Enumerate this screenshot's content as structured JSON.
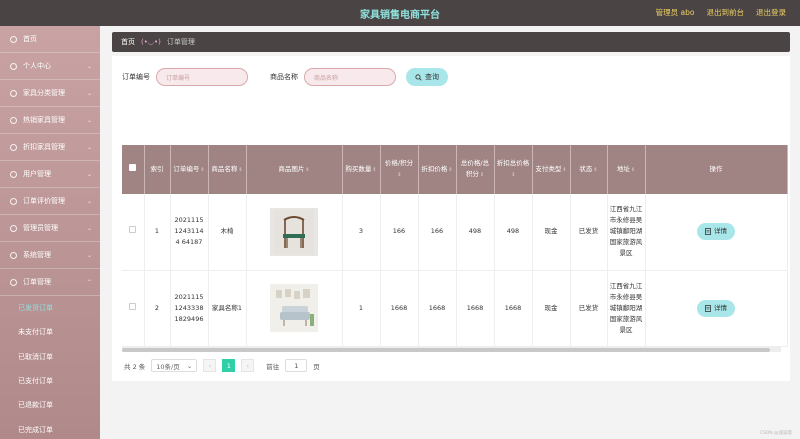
{
  "header": {
    "title": "家具销售电商平台",
    "user": "管理员 abo",
    "to_front": "退出到前台",
    "logout": "退出登录"
  },
  "sidebar": {
    "items": [
      {
        "label": "首页"
      },
      {
        "label": "个人中心"
      },
      {
        "label": "家具分类管理"
      },
      {
        "label": "热销家具管理"
      },
      {
        "label": "折扣家具管理"
      },
      {
        "label": "用户管理"
      },
      {
        "label": "订单评价管理"
      },
      {
        "label": "管理员管理"
      },
      {
        "label": "系统管理"
      },
      {
        "label": "订单管理"
      }
    ],
    "sub_items": [
      {
        "label": "已发货订单"
      },
      {
        "label": "未支付订单"
      },
      {
        "label": "已取消订单"
      },
      {
        "label": "已支付订单"
      },
      {
        "label": "已退款订单"
      },
      {
        "label": "已完成订单"
      }
    ]
  },
  "breadcrumb": {
    "home": "首页",
    "sep": "(•◡•)",
    "current": "订单管理"
  },
  "search": {
    "order_no_label": "订单编号",
    "order_no_placeholder": "订单编号",
    "product_label": "商品名称",
    "product_placeholder": "商品名称",
    "query_label": "查询"
  },
  "table": {
    "headers": {
      "index": "索引",
      "order_no": "订单编号",
      "product": "商品名称",
      "image": "商品图片",
      "qty": "购买数量",
      "price": "价格/积分",
      "discount_price": "折扣价格",
      "total": "总价格/总积分",
      "discount_total": "折扣总价格",
      "pay_type": "支付类型",
      "status": "状态",
      "address": "地址",
      "action": "操作"
    },
    "rows": [
      {
        "index": "1",
        "order_no": "202111512431144 64187",
        "product": "木椅",
        "qty": "3",
        "price": "166",
        "discount_price": "166",
        "total": "498",
        "discount_total": "498",
        "pay_type": "现金",
        "status": "已发货",
        "address": "江西省九江市永修县吴城镇鄱阳湖国家旅游风景区",
        "action": "详情"
      },
      {
        "index": "2",
        "order_no": "20211151243338 1829496",
        "product": "家具名称1",
        "qty": "1",
        "price": "1668",
        "discount_price": "1668",
        "total": "1668",
        "discount_total": "1668",
        "pay_type": "现金",
        "status": "已发货",
        "address": "江西省九江市永修县吴城镇鄱阳湖国家旅游风景区",
        "action": "详情"
      }
    ]
  },
  "pager": {
    "total": "共 2 条",
    "page_size": "10条/页",
    "current": "1",
    "goto": "前往",
    "goto_value": "1",
    "page_unit": "页"
  },
  "watermark": "CSDN @诚诚斋"
}
